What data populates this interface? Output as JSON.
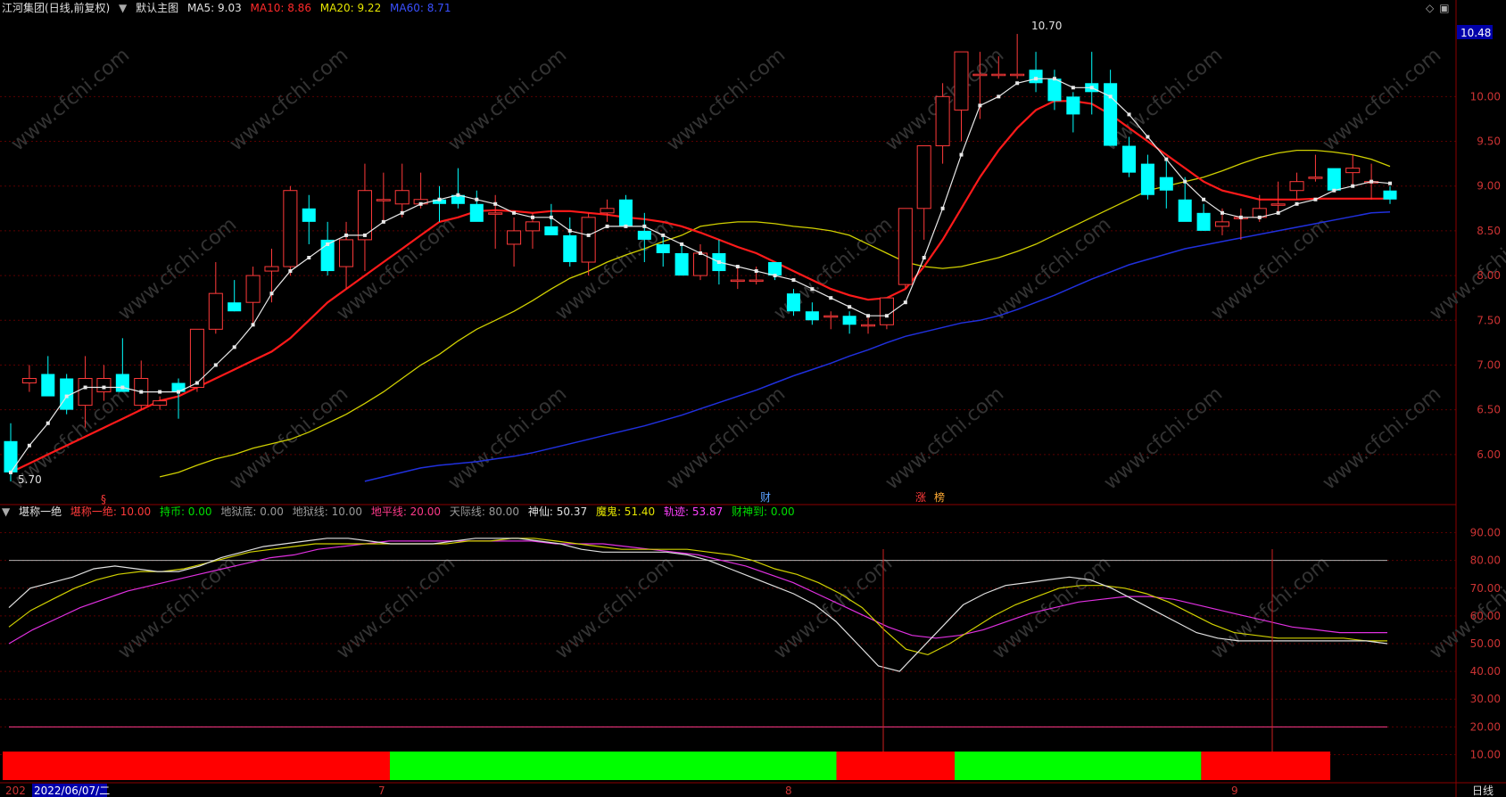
{
  "header": {
    "stock_name": "江河集团",
    "period_label": "(日线,前复权)",
    "main_chart_label": "默认主图",
    "ma": [
      {
        "label": "MA5: 9.03",
        "color": "#e0e0e0"
      },
      {
        "label": "MA10: 8.86",
        "color": "#ff2a2a"
      },
      {
        "label": "MA20: 9.22",
        "color": "#e5e500"
      },
      {
        "label": "MA60: 8.71",
        "color": "#3a50ff"
      }
    ]
  },
  "price_axis": {
    "ticks": [
      "10.00",
      "9.50",
      "9.00",
      "8.50",
      "8.00",
      "7.50",
      "7.00",
      "6.50",
      "6.00"
    ],
    "current_price_label": "10.48",
    "high_label": "10.70",
    "low_label": "5.70"
  },
  "event_markers": [
    {
      "text": "§",
      "color": "#ff3a3a"
    },
    {
      "text": "财",
      "color": "#5aa0ff"
    },
    {
      "text": "涨",
      "color": "#ff3a3a"
    },
    {
      "text": "榜",
      "color": "#ffaa33"
    }
  ],
  "indicator": {
    "name": "堪称一绝",
    "values": [
      {
        "label": "堪称一绝: 10.00",
        "color": "#ff3a3a"
      },
      {
        "label": "持币: 0.00",
        "color": "#00e000"
      },
      {
        "label": "地狱底: 0.00",
        "color": "#9a9a9a"
      },
      {
        "label": "地狱线: 10.00",
        "color": "#9a9a9a"
      },
      {
        "label": "地平线: 20.00",
        "color": "#ff3a8a"
      },
      {
        "label": "天际线: 80.00",
        "color": "#9a9a9a"
      },
      {
        "label": "神仙: 50.37",
        "color": "#e0e0e0"
      },
      {
        "label": "魔鬼: 51.40",
        "color": "#e5e500"
      },
      {
        "label": "轨迹: 53.87",
        "color": "#ff40ff"
      },
      {
        "label": "财神到: 0.00",
        "color": "#00e000"
      }
    ],
    "axis_ticks": [
      "90.00",
      "80.00",
      "70.00",
      "60.00",
      "50.00",
      "40.00",
      "30.00",
      "20.00",
      "10.00"
    ]
  },
  "time_axis": {
    "start_label": "202",
    "cursor_date": "2022/06/07/二",
    "month_labels": [
      "7",
      "8",
      "9"
    ]
  },
  "period_button": "日线",
  "colors": {
    "up": "#ff3a3a",
    "down": "#00ffff",
    "bull_bar": "#00ff00",
    "bear_bar": "#ff0000"
  },
  "chart_data": {
    "type": "candlestick",
    "candles": [
      [
        6.15,
        6.35,
        5.7,
        5.8
      ],
      [
        6.8,
        7.0,
        6.7,
        6.85
      ],
      [
        6.9,
        7.1,
        6.85,
        6.65
      ],
      [
        6.85,
        6.9,
        6.45,
        6.5
      ],
      [
        6.55,
        7.1,
        6.3,
        6.85
      ],
      [
        6.7,
        7.0,
        6.6,
        6.85
      ],
      [
        6.9,
        7.3,
        6.8,
        6.7
      ],
      [
        6.55,
        7.05,
        6.5,
        6.85
      ],
      [
        6.55,
        6.65,
        6.5,
        6.6
      ],
      [
        6.8,
        6.85,
        6.4,
        6.7
      ],
      [
        6.75,
        7.4,
        6.7,
        7.4
      ],
      [
        7.4,
        8.15,
        7.35,
        7.8
      ],
      [
        7.7,
        7.95,
        7.6,
        7.6
      ],
      [
        7.7,
        8.1,
        7.45,
        8.0
      ],
      [
        8.05,
        8.3,
        7.7,
        8.1
      ],
      [
        8.1,
        9.0,
        8.0,
        8.95
      ],
      [
        8.75,
        8.9,
        8.35,
        8.6
      ],
      [
        8.4,
        8.6,
        8.0,
        8.05
      ],
      [
        8.1,
        8.6,
        7.85,
        8.4
      ],
      [
        8.4,
        9.25,
        8.05,
        8.95
      ],
      [
        8.85,
        9.15,
        8.6,
        8.85
      ],
      [
        8.8,
        9.25,
        8.65,
        8.95
      ],
      [
        8.8,
        9.15,
        8.75,
        8.85
      ],
      [
        8.85,
        9.0,
        8.6,
        8.8
      ],
      [
        8.9,
        9.2,
        8.75,
        8.8
      ],
      [
        8.8,
        8.95,
        8.7,
        8.6
      ],
      [
        8.7,
        8.9,
        8.3,
        8.7
      ],
      [
        8.35,
        8.65,
        8.1,
        8.5
      ],
      [
        8.5,
        8.7,
        8.3,
        8.6
      ],
      [
        8.55,
        8.8,
        8.55,
        8.45
      ],
      [
        8.45,
        8.65,
        8.1,
        8.15
      ],
      [
        8.15,
        8.7,
        8.0,
        8.65
      ],
      [
        8.7,
        8.85,
        8.6,
        8.75
      ],
      [
        8.85,
        8.9,
        8.55,
        8.55
      ],
      [
        8.5,
        8.7,
        8.15,
        8.4
      ],
      [
        8.35,
        8.45,
        8.1,
        8.25
      ],
      [
        8.25,
        8.35,
        8.0,
        8.0
      ],
      [
        8.0,
        8.35,
        7.95,
        8.25
      ],
      [
        8.25,
        8.4,
        7.9,
        8.05
      ],
      [
        7.95,
        8.1,
        7.85,
        7.95
      ],
      [
        7.95,
        8.1,
        7.9,
        7.95
      ],
      [
        8.15,
        8.15,
        7.95,
        8.0
      ],
      [
        7.8,
        7.85,
        7.55,
        7.6
      ],
      [
        7.6,
        7.7,
        7.45,
        7.5
      ],
      [
        7.55,
        7.6,
        7.4,
        7.55
      ],
      [
        7.55,
        7.6,
        7.35,
        7.45
      ],
      [
        7.45,
        7.55,
        7.35,
        7.45
      ],
      [
        7.45,
        7.75,
        7.4,
        7.75
      ],
      [
        7.9,
        8.15,
        7.85,
        8.75
      ],
      [
        8.75,
        9.4,
        8.4,
        9.45
      ],
      [
        9.45,
        10.15,
        9.25,
        10.0
      ],
      [
        9.85,
        10.45,
        9.5,
        10.5
      ],
      [
        10.25,
        10.5,
        9.75,
        10.25
      ],
      [
        10.25,
        10.45,
        10.2,
        10.25
      ],
      [
        10.25,
        10.7,
        10.2,
        10.25
      ],
      [
        10.3,
        10.5,
        10.05,
        10.15
      ],
      [
        10.2,
        10.3,
        9.85,
        9.95
      ],
      [
        10.0,
        10.05,
        9.6,
        9.8
      ],
      [
        10.15,
        10.5,
        9.8,
        10.05
      ],
      [
        10.15,
        10.3,
        9.45,
        9.45
      ],
      [
        9.45,
        9.55,
        9.1,
        9.15
      ],
      [
        9.25,
        9.35,
        8.85,
        8.9
      ],
      [
        9.1,
        9.3,
        8.75,
        8.95
      ],
      [
        8.85,
        9.1,
        8.75,
        8.6
      ],
      [
        8.7,
        8.8,
        8.5,
        8.5
      ],
      [
        8.55,
        8.75,
        8.45,
        8.6
      ],
      [
        8.65,
        8.75,
        8.4,
        8.65
      ],
      [
        8.65,
        8.9,
        8.6,
        8.75
      ],
      [
        8.8,
        9.05,
        8.7,
        8.8
      ],
      [
        8.95,
        9.15,
        8.85,
        9.05
      ],
      [
        9.1,
        9.35,
        9.05,
        9.1
      ],
      [
        9.2,
        9.15,
        9.0,
        8.95
      ],
      [
        9.15,
        9.35,
        9.0,
        9.2
      ],
      [
        9.05,
        9.25,
        8.85,
        9.05
      ],
      [
        8.95,
        9.0,
        8.8,
        8.85
      ]
    ],
    "ma5": [
      5.8,
      6.1,
      6.35,
      6.65,
      6.75,
      6.75,
      6.75,
      6.7,
      6.7,
      6.7,
      6.8,
      7.0,
      7.2,
      7.45,
      7.8,
      8.05,
      8.2,
      8.35,
      8.45,
      8.45,
      8.6,
      8.7,
      8.8,
      8.85,
      8.9,
      8.85,
      8.8,
      8.7,
      8.65,
      8.65,
      8.5,
      8.45,
      8.55,
      8.55,
      8.55,
      8.45,
      8.35,
      8.25,
      8.15,
      8.1,
      8.05,
      8.0,
      7.95,
      7.85,
      7.75,
      7.65,
      7.55,
      7.55,
      7.7,
      8.2,
      8.75,
      9.35,
      9.9,
      10.0,
      10.15,
      10.2,
      10.2,
      10.1,
      10.1,
      10.0,
      9.8,
      9.55,
      9.3,
      9.05,
      8.85,
      8.7,
      8.65,
      8.65,
      8.7,
      8.8,
      8.85,
      8.95,
      9.0,
      9.05,
      9.03
    ],
    "ma10": [
      5.8,
      5.9,
      6.0,
      6.1,
      6.2,
      6.3,
      6.4,
      6.5,
      6.6,
      6.65,
      6.75,
      6.85,
      6.95,
      7.05,
      7.15,
      7.3,
      7.5,
      7.7,
      7.85,
      8.0,
      8.15,
      8.3,
      8.45,
      8.6,
      8.65,
      8.72,
      8.73,
      8.72,
      8.7,
      8.72,
      8.72,
      8.7,
      8.68,
      8.65,
      8.63,
      8.6,
      8.55,
      8.48,
      8.4,
      8.32,
      8.25,
      8.15,
      8.05,
      7.95,
      7.85,
      7.78,
      7.73,
      7.75,
      7.85,
      8.1,
      8.4,
      8.75,
      9.1,
      9.4,
      9.65,
      9.85,
      9.95,
      9.95,
      9.92,
      9.8,
      9.65,
      9.5,
      9.35,
      9.2,
      9.05,
      8.95,
      8.9,
      8.85,
      8.85,
      8.85,
      8.86,
      8.86,
      8.86,
      8.86,
      8.86
    ],
    "ma20": [
      5.75,
      5.8,
      5.88,
      5.95,
      6.0,
      6.07,
      6.12,
      6.17,
      6.25,
      6.35,
      6.45,
      6.57,
      6.7,
      6.85,
      7.0,
      7.12,
      7.27,
      7.4,
      7.5,
      7.6,
      7.72,
      7.85,
      7.97,
      8.05,
      8.15,
      8.23,
      8.3,
      8.38,
      8.45,
      8.55,
      8.58,
      8.6,
      8.6,
      8.58,
      8.55,
      8.53,
      8.5,
      8.45,
      8.35,
      8.25,
      8.15,
      8.1,
      8.08,
      8.1,
      8.15,
      8.2,
      8.27,
      8.35,
      8.45,
      8.55,
      8.65,
      8.75,
      8.85,
      8.95,
      9.0,
      9.05,
      9.1,
      9.17,
      9.25,
      9.32,
      9.37,
      9.4,
      9.4,
      9.38,
      9.35,
      9.3,
      9.22
    ],
    "ma60": [
      5.7,
      5.75,
      5.8,
      5.85,
      5.88,
      5.9,
      5.92,
      5.95,
      5.98,
      6.02,
      6.07,
      6.12,
      6.17,
      6.22,
      6.27,
      6.32,
      6.38,
      6.44,
      6.51,
      6.58,
      6.65,
      6.72,
      6.8,
      6.88,
      6.95,
      7.02,
      7.1,
      7.17,
      7.25,
      7.32,
      7.37,
      7.42,
      7.47,
      7.5,
      7.55,
      7.62,
      7.7,
      7.78,
      7.87,
      7.96,
      8.04,
      8.12,
      8.18,
      8.24,
      8.3,
      8.34,
      8.38,
      8.42,
      8.46,
      8.5,
      8.54,
      8.58,
      8.62,
      8.66,
      8.7,
      8.71
    ],
    "osc_white": [
      63,
      70,
      72,
      74,
      77,
      78,
      77,
      76,
      76,
      78,
      81,
      83,
      85,
      86,
      87,
      88,
      88,
      87,
      86,
      86,
      86,
      87,
      88,
      88,
      88,
      87,
      86,
      84,
      83,
      83,
      83,
      83,
      82,
      80,
      77,
      74,
      71,
      68,
      64,
      58,
      50,
      42,
      40,
      48,
      56,
      64,
      68,
      71,
      72,
      73,
      74,
      73,
      70,
      66,
      62,
      58,
      54,
      52,
      51,
      51,
      51,
      51,
      51,
      51,
      51,
      50
    ],
    "osc_yellow": [
      56,
      62,
      66,
      70,
      73,
      75,
      76,
      76,
      77,
      79,
      81,
      83,
      84,
      85,
      86,
      86,
      86,
      86,
      86,
      86,
      86,
      87,
      87,
      88,
      88,
      87,
      86,
      85,
      84,
      84,
      84,
      84,
      83,
      82,
      80,
      77,
      75,
      72,
      68,
      63,
      55,
      48,
      46,
      50,
      55,
      60,
      64,
      67,
      70,
      71,
      71,
      70,
      68,
      65,
      61,
      57,
      54,
      53,
      52,
      52,
      52,
      52,
      51,
      51
    ],
    "osc_magenta": [
      50,
      55,
      59,
      63,
      66,
      69,
      71,
      73,
      75,
      77,
      79,
      81,
      82,
      84,
      85,
      86,
      87,
      87,
      87,
      87,
      87,
      87,
      87,
      86,
      86,
      86,
      85,
      84,
      83,
      82,
      80,
      78,
      75,
      72,
      68,
      64,
      60,
      56,
      53,
      52,
      53,
      55,
      58,
      61,
      63,
      65,
      66,
      67,
      67,
      66,
      64,
      62,
      60,
      58,
      56,
      55,
      54,
      54,
      54
    ],
    "bar_segments": [
      {
        "signal": "red",
        "length": 0.2745
      },
      {
        "signal": "green",
        "length": 0.3166
      },
      {
        "signal": "red",
        "length": 0.0838
      },
      {
        "signal": "green",
        "length": 0.1748
      },
      {
        "signal": "red",
        "length": 0.0915
      }
    ],
    "osc_levels": [
      80,
      20
    ],
    "price_ylim": [
      5.55,
      10.88
    ],
    "osc_ylim": [
      5,
      95
    ]
  }
}
